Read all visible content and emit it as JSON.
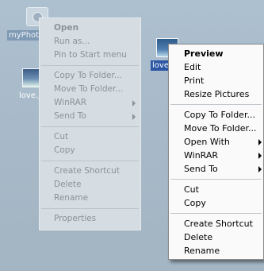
{
  "desktop": {
    "icons": [
      {
        "label": "myPhoto"
      },
      {
        "label": "love.j"
      },
      {
        "label": "love"
      }
    ]
  },
  "faded_menu": {
    "items": {
      "open": "Open",
      "run_as": "Run as...",
      "pin_start": "Pin to Start menu",
      "copy_folder": "Copy To Folder...",
      "move_folder": "Move To Folder...",
      "winrar": "WinRAR",
      "send_to": "Send To",
      "cut": "Cut",
      "copy": "Copy",
      "create_shortcut": "Create Shortcut",
      "delete": "Delete",
      "rename": "Rename",
      "properties": "Properties"
    }
  },
  "main_menu": {
    "items": {
      "preview": "Preview",
      "edit": "Edit",
      "print": "Print",
      "resize": "Resize Pictures",
      "copy_folder": "Copy To Folder...",
      "move_folder": "Move To Folder...",
      "open_with": "Open With",
      "winrar": "WinRAR",
      "send_to": "Send To",
      "cut": "Cut",
      "copy": "Copy",
      "create_shortcut": "Create Shortcut",
      "delete": "Delete",
      "rename": "Rename"
    }
  }
}
